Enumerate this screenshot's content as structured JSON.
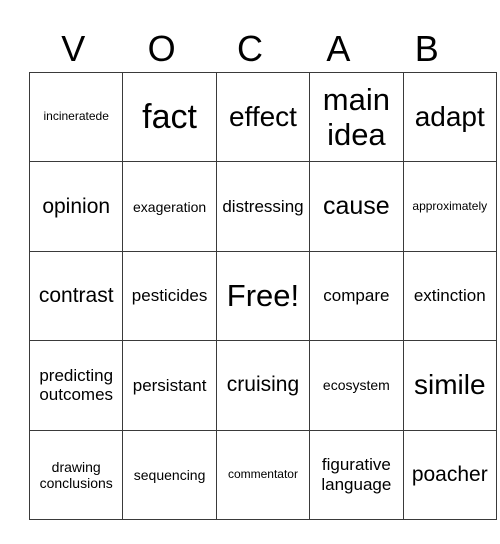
{
  "header": {
    "letters": [
      "V",
      "O",
      "C",
      "A",
      "B"
    ]
  },
  "grid": {
    "rows": [
      [
        "incineratede",
        "fact",
        "effect",
        "main idea",
        "adapt"
      ],
      [
        "opinion",
        "exageration",
        "distressing",
        "cause",
        "approximately"
      ],
      [
        "contrast",
        "pesticides",
        "Free!",
        "compare",
        "extinction"
      ],
      [
        "predicting outcomes",
        "persistant",
        "cruising",
        "ecosystem",
        "simile"
      ],
      [
        "drawing conclusions",
        "sequencing",
        "commentator",
        "figurative language",
        "poacher"
      ]
    ]
  }
}
